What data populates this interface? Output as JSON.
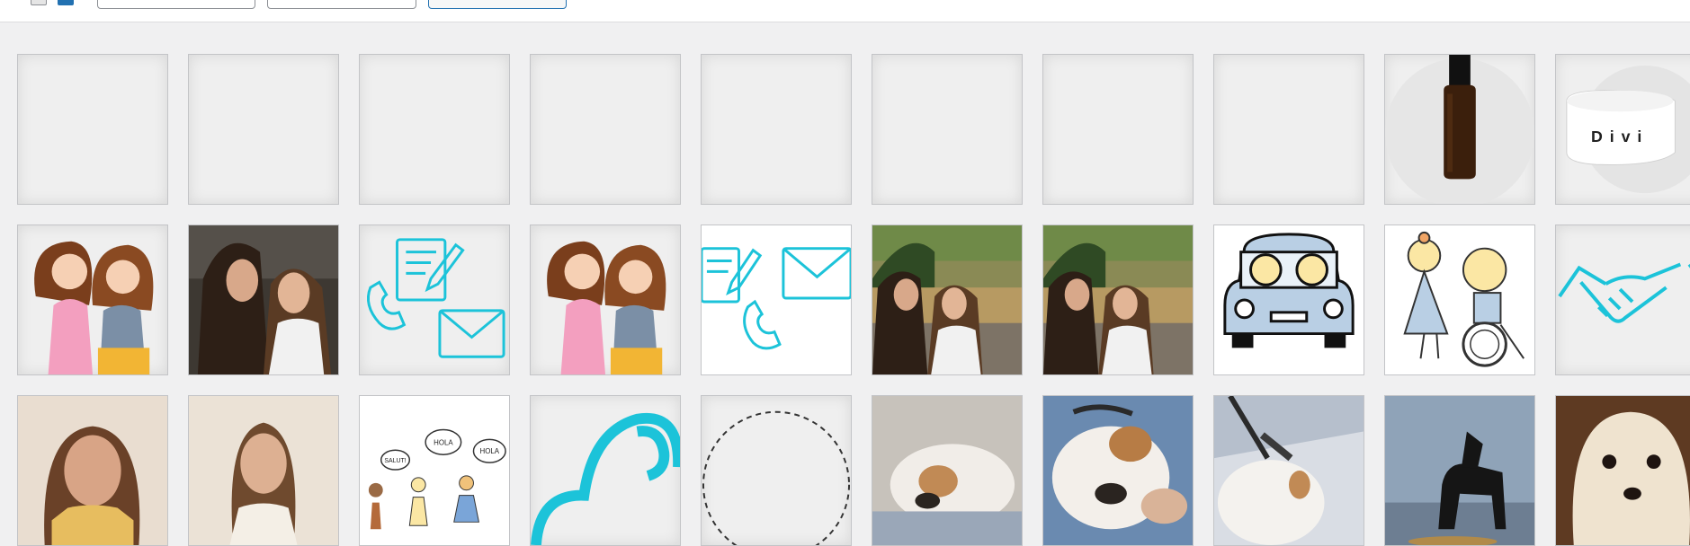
{
  "toolbar": {
    "controls": [
      "checkbox",
      "checkbox-checked",
      "filter-select",
      "date-select",
      "action-button"
    ]
  },
  "grid": {
    "row1": [
      {
        "name": "media-item-placeholder-1"
      },
      {
        "name": "media-item-placeholder-2"
      },
      {
        "name": "media-item-placeholder-3"
      },
      {
        "name": "media-item-placeholder-4"
      },
      {
        "name": "media-item-placeholder-5"
      },
      {
        "name": "media-item-placeholder-6"
      },
      {
        "name": "media-item-placeholder-7"
      },
      {
        "name": "media-item-placeholder-8"
      },
      {
        "name": "media-item-bottle"
      },
      {
        "name": "media-item-divi-jar",
        "label": "Divi"
      }
    ],
    "row2": [
      {
        "name": "media-item-cartoon-women"
      },
      {
        "name": "media-item-photo-two-women"
      },
      {
        "name": "media-item-contact-icons"
      },
      {
        "name": "media-item-cartoon-women-2"
      },
      {
        "name": "media-item-contact-icons-2"
      },
      {
        "name": "media-item-photo-field-1"
      },
      {
        "name": "media-item-photo-field-2"
      },
      {
        "name": "media-item-car-drawing"
      },
      {
        "name": "media-item-wheelchair-drawing"
      },
      {
        "name": "media-item-handshake-icon"
      }
    ],
    "row3": [
      {
        "name": "media-item-photo-woman-1"
      },
      {
        "name": "media-item-photo-woman-2"
      },
      {
        "name": "media-item-kids-speech",
        "speech": [
          "SALUT!",
          "HOLA",
          "HOLA"
        ]
      },
      {
        "name": "media-item-cyan-shape"
      },
      {
        "name": "media-item-dashed-circle"
      },
      {
        "name": "media-item-photo-bulldog-1"
      },
      {
        "name": "media-item-photo-bulldog-2"
      },
      {
        "name": "media-item-photo-bulldog-3"
      },
      {
        "name": "media-item-photo-black-dog"
      },
      {
        "name": "media-item-photo-terrier"
      }
    ]
  },
  "colors": {
    "accent": "#2271b1",
    "cyan": "#1cc3d9",
    "tile_bg": "#efefef",
    "border": "#c3c4c7"
  }
}
